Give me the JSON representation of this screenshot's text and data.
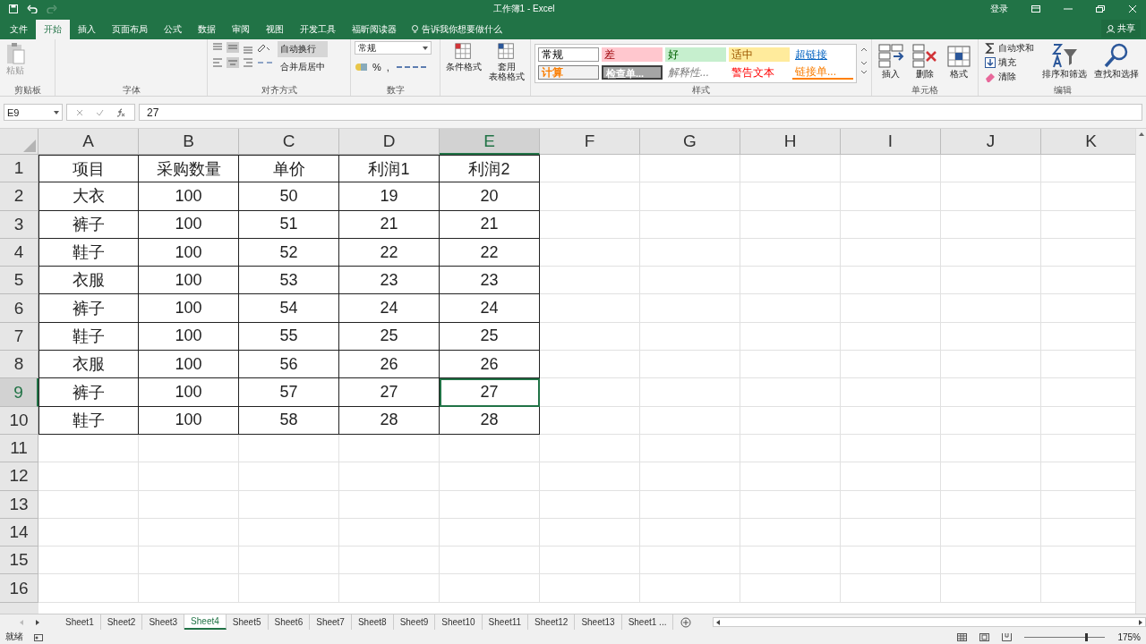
{
  "window": {
    "title": "工作簿1 - Excel",
    "signin": "登录"
  },
  "tabs": [
    {
      "label": "文件",
      "selected": false
    },
    {
      "label": "开始",
      "selected": true
    },
    {
      "label": "插入",
      "selected": false
    },
    {
      "label": "页面布局",
      "selected": false
    },
    {
      "label": "公式",
      "selected": false
    },
    {
      "label": "数据",
      "selected": false
    },
    {
      "label": "审阅",
      "selected": false
    },
    {
      "label": "视图",
      "selected": false
    },
    {
      "label": "开发工具",
      "selected": false
    },
    {
      "label": "福昕阅读器",
      "selected": false
    }
  ],
  "tell_me": {
    "placeholder": "告诉我你想要做什么"
  },
  "share": "共享",
  "ribbon": {
    "clipboard": {
      "label": "剪贴板",
      "paste": {
        "label": "粘贴",
        "disabled": true
      }
    },
    "font": {
      "label": "字体"
    },
    "alignment": {
      "label": "对齐方式",
      "wrap": {
        "label": "自动换行",
        "selected": true
      },
      "merge": {
        "label": "合并后居中",
        "selected": false
      }
    },
    "number": {
      "label": "数字",
      "format": "常规",
      "percent": "%",
      "comma": ","
    },
    "table_tools": [
      {
        "lines": [
          "条件格式"
        ]
      },
      {
        "lines": [
          "套用",
          "表格格式"
        ]
      }
    ],
    "styles": {
      "label": "样式",
      "items": [
        {
          "label": "常规",
          "kind": "normal"
        },
        {
          "label": "差",
          "kind": "bad"
        },
        {
          "label": "好",
          "kind": "good"
        },
        {
          "label": "适中",
          "kind": "neutral"
        },
        {
          "label": "超链接",
          "kind": "hyperlink"
        },
        {
          "label": "计算",
          "kind": "calculation"
        },
        {
          "label": "检查单...",
          "kind": "check"
        },
        {
          "label": "解释性...",
          "kind": "explanatory"
        },
        {
          "label": "警告文本",
          "kind": "warning"
        },
        {
          "label": "链接单...",
          "kind": "linked"
        }
      ]
    },
    "cells": {
      "label": "单元格",
      "items": [
        {
          "label": "插入",
          "kind": "insert"
        },
        {
          "label": "删除",
          "kind": "delete"
        },
        {
          "label": "格式",
          "kind": "format"
        }
      ]
    },
    "editing": {
      "label": "编辑",
      "small": [
        {
          "label": "自动求和",
          "kind": "sum"
        },
        {
          "label": "填充",
          "kind": "fill"
        },
        {
          "label": "清除",
          "kind": "clear"
        }
      ],
      "large": [
        {
          "label": "排序和筛选",
          "kind": "sort"
        },
        {
          "label": "查找和选择",
          "kind": "find"
        }
      ]
    }
  },
  "formula_bar": {
    "name_box": "E9",
    "value": "27"
  },
  "sheet": {
    "columns": [
      {
        "label": "A",
        "selected": false
      },
      {
        "label": "B",
        "selected": false
      },
      {
        "label": "C",
        "selected": false
      },
      {
        "label": "D",
        "selected": false
      },
      {
        "label": "E",
        "selected": true
      },
      {
        "label": "F",
        "selected": false
      },
      {
        "label": "G",
        "selected": false
      },
      {
        "label": "H",
        "selected": false
      },
      {
        "label": "I",
        "selected": false
      },
      {
        "label": "J",
        "selected": false
      },
      {
        "label": "K",
        "selected": false
      }
    ],
    "rows": [
      {
        "label": "1",
        "selected": false,
        "cells": [
          "项目",
          "采购数量",
          "单价",
          "利润1",
          "利润2"
        ]
      },
      {
        "label": "2",
        "selected": false,
        "cells": [
          "大衣",
          "100",
          "50",
          "19",
          "20"
        ]
      },
      {
        "label": "3",
        "selected": false,
        "cells": [
          "裤子",
          "100",
          "51",
          "21",
          "21"
        ]
      },
      {
        "label": "4",
        "selected": false,
        "cells": [
          "鞋子",
          "100",
          "52",
          "22",
          "22"
        ]
      },
      {
        "label": "5",
        "selected": false,
        "cells": [
          "衣服",
          "100",
          "53",
          "23",
          "23"
        ]
      },
      {
        "label": "6",
        "selected": false,
        "cells": [
          "裤子",
          "100",
          "54",
          "24",
          "24"
        ]
      },
      {
        "label": "7",
        "selected": false,
        "cells": [
          "鞋子",
          "100",
          "55",
          "25",
          "25"
        ]
      },
      {
        "label": "8",
        "selected": false,
        "cells": [
          "衣服",
          "100",
          "56",
          "26",
          "26"
        ]
      },
      {
        "label": "9",
        "selected": true,
        "cells": [
          "裤子",
          "100",
          "57",
          "27",
          "27"
        ]
      },
      {
        "label": "10",
        "selected": false,
        "cells": [
          "鞋子",
          "100",
          "58",
          "28",
          "28"
        ]
      },
      {
        "label": "11",
        "selected": false,
        "cells": []
      },
      {
        "label": "12",
        "selected": false,
        "cells": []
      },
      {
        "label": "13",
        "selected": false,
        "cells": []
      },
      {
        "label": "14",
        "selected": false,
        "cells": []
      },
      {
        "label": "15",
        "selected": false,
        "cells": []
      },
      {
        "label": "16",
        "selected": false,
        "cells": []
      }
    ]
  },
  "sheet_tabs": [
    {
      "label": "Sheet1",
      "selected": false
    },
    {
      "label": "Sheet2",
      "selected": false
    },
    {
      "label": "Sheet3",
      "selected": false
    },
    {
      "label": "Sheet4",
      "selected": true
    },
    {
      "label": "Sheet5",
      "selected": false
    },
    {
      "label": "Sheet6",
      "selected": false
    },
    {
      "label": "Sheet7",
      "selected": false
    },
    {
      "label": "Sheet8",
      "selected": false
    },
    {
      "label": "Sheet9",
      "selected": false
    },
    {
      "label": "Sheet10",
      "selected": false
    },
    {
      "label": "Sheet11",
      "selected": false
    },
    {
      "label": "Sheet12",
      "selected": false
    },
    {
      "label": "Sheet13",
      "selected": false
    },
    {
      "label": "Sheet1 ...",
      "selected": false
    }
  ],
  "status_bar": {
    "status": "就绪",
    "zoom": "175%",
    "level": 0.75
  }
}
